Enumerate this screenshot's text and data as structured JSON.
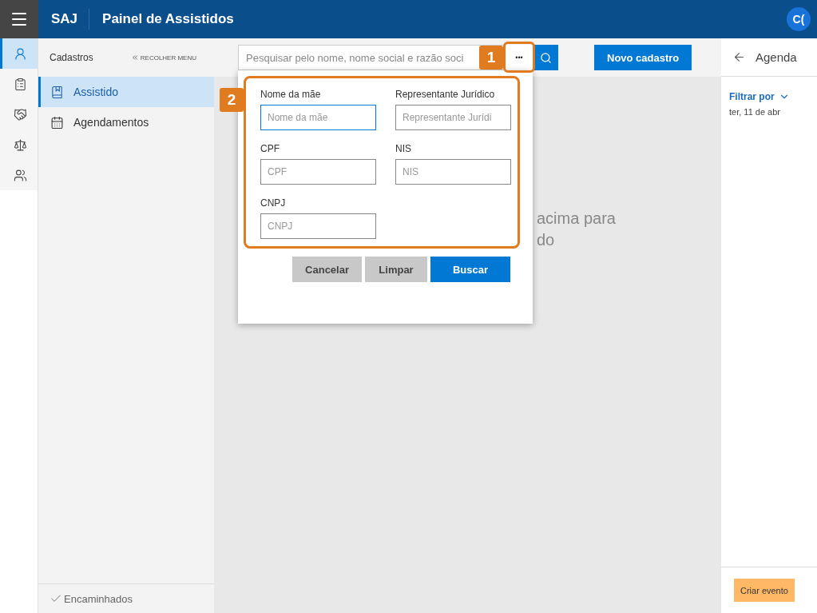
{
  "header": {
    "logo": "SAJ",
    "title": "Painel de Assistidos",
    "avatar": "C("
  },
  "rail": [
    {
      "selected": true
    },
    {
      "selected": false
    },
    {
      "selected": false
    },
    {
      "selected": false
    },
    {
      "selected": false
    }
  ],
  "sidebar": {
    "title": "Cadastros",
    "collapse": "RECOLHER MENU",
    "items": [
      {
        "label": "Assistido",
        "selected": true
      },
      {
        "label": "Agendamentos",
        "selected": false
      }
    ],
    "footer": "Encaminhados"
  },
  "search": {
    "placeholder": "Pesquisar pelo nome, nome social e razão soci",
    "more": "•••"
  },
  "new_button": "Novo cadastro",
  "message": [
    "acima para",
    "do"
  ],
  "popup": {
    "fields": [
      {
        "label": "Nome da mãe",
        "placeholder": "Nome da mãe",
        "focused": true
      },
      {
        "label": "Representante Jurídico",
        "placeholder": "Representante Jurídi",
        "focused": false
      },
      {
        "label": "CPF",
        "placeholder": "CPF",
        "focused": false
      },
      {
        "label": "NIS",
        "placeholder": "NIS",
        "focused": false
      },
      {
        "label": "CNPJ",
        "placeholder": "CNPJ",
        "focused": false
      }
    ],
    "buttons": [
      {
        "label": "Cancelar",
        "kind": "secondary"
      },
      {
        "label": "Limpar",
        "kind": "secondary"
      },
      {
        "label": "Buscar",
        "kind": "primary"
      }
    ]
  },
  "annotations": [
    "1",
    "2"
  ],
  "agenda": {
    "title": "Agenda",
    "filter": "Filtrar por",
    "date": "ter, 11 de abr",
    "create": "Criar evento"
  }
}
